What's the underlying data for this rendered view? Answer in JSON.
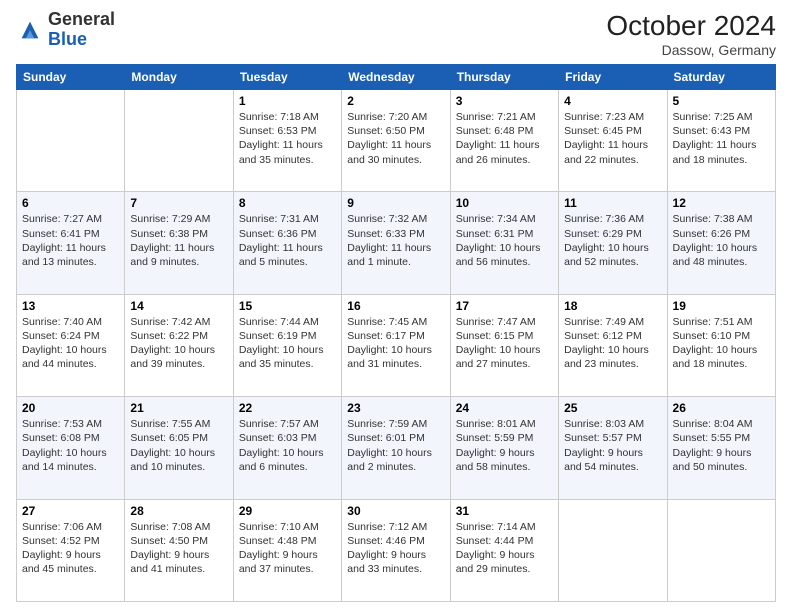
{
  "header": {
    "logo_general": "General",
    "logo_blue": "Blue",
    "month_title": "October 2024",
    "location": "Dassow, Germany"
  },
  "days_of_week": [
    "Sunday",
    "Monday",
    "Tuesday",
    "Wednesday",
    "Thursday",
    "Friday",
    "Saturday"
  ],
  "weeks": [
    [
      {
        "day": "",
        "sunrise": "",
        "sunset": "",
        "daylight": ""
      },
      {
        "day": "",
        "sunrise": "",
        "sunset": "",
        "daylight": ""
      },
      {
        "day": "1",
        "sunrise": "Sunrise: 7:18 AM",
        "sunset": "Sunset: 6:53 PM",
        "daylight": "Daylight: 11 hours and 35 minutes."
      },
      {
        "day": "2",
        "sunrise": "Sunrise: 7:20 AM",
        "sunset": "Sunset: 6:50 PM",
        "daylight": "Daylight: 11 hours and 30 minutes."
      },
      {
        "day": "3",
        "sunrise": "Sunrise: 7:21 AM",
        "sunset": "Sunset: 6:48 PM",
        "daylight": "Daylight: 11 hours and 26 minutes."
      },
      {
        "day": "4",
        "sunrise": "Sunrise: 7:23 AM",
        "sunset": "Sunset: 6:45 PM",
        "daylight": "Daylight: 11 hours and 22 minutes."
      },
      {
        "day": "5",
        "sunrise": "Sunrise: 7:25 AM",
        "sunset": "Sunset: 6:43 PM",
        "daylight": "Daylight: 11 hours and 18 minutes."
      }
    ],
    [
      {
        "day": "6",
        "sunrise": "Sunrise: 7:27 AM",
        "sunset": "Sunset: 6:41 PM",
        "daylight": "Daylight: 11 hours and 13 minutes."
      },
      {
        "day": "7",
        "sunrise": "Sunrise: 7:29 AM",
        "sunset": "Sunset: 6:38 PM",
        "daylight": "Daylight: 11 hours and 9 minutes."
      },
      {
        "day": "8",
        "sunrise": "Sunrise: 7:31 AM",
        "sunset": "Sunset: 6:36 PM",
        "daylight": "Daylight: 11 hours and 5 minutes."
      },
      {
        "day": "9",
        "sunrise": "Sunrise: 7:32 AM",
        "sunset": "Sunset: 6:33 PM",
        "daylight": "Daylight: 11 hours and 1 minute."
      },
      {
        "day": "10",
        "sunrise": "Sunrise: 7:34 AM",
        "sunset": "Sunset: 6:31 PM",
        "daylight": "Daylight: 10 hours and 56 minutes."
      },
      {
        "day": "11",
        "sunrise": "Sunrise: 7:36 AM",
        "sunset": "Sunset: 6:29 PM",
        "daylight": "Daylight: 10 hours and 52 minutes."
      },
      {
        "day": "12",
        "sunrise": "Sunrise: 7:38 AM",
        "sunset": "Sunset: 6:26 PM",
        "daylight": "Daylight: 10 hours and 48 minutes."
      }
    ],
    [
      {
        "day": "13",
        "sunrise": "Sunrise: 7:40 AM",
        "sunset": "Sunset: 6:24 PM",
        "daylight": "Daylight: 10 hours and 44 minutes."
      },
      {
        "day": "14",
        "sunrise": "Sunrise: 7:42 AM",
        "sunset": "Sunset: 6:22 PM",
        "daylight": "Daylight: 10 hours and 39 minutes."
      },
      {
        "day": "15",
        "sunrise": "Sunrise: 7:44 AM",
        "sunset": "Sunset: 6:19 PM",
        "daylight": "Daylight: 10 hours and 35 minutes."
      },
      {
        "day": "16",
        "sunrise": "Sunrise: 7:45 AM",
        "sunset": "Sunset: 6:17 PM",
        "daylight": "Daylight: 10 hours and 31 minutes."
      },
      {
        "day": "17",
        "sunrise": "Sunrise: 7:47 AM",
        "sunset": "Sunset: 6:15 PM",
        "daylight": "Daylight: 10 hours and 27 minutes."
      },
      {
        "day": "18",
        "sunrise": "Sunrise: 7:49 AM",
        "sunset": "Sunset: 6:12 PM",
        "daylight": "Daylight: 10 hours and 23 minutes."
      },
      {
        "day": "19",
        "sunrise": "Sunrise: 7:51 AM",
        "sunset": "Sunset: 6:10 PM",
        "daylight": "Daylight: 10 hours and 18 minutes."
      }
    ],
    [
      {
        "day": "20",
        "sunrise": "Sunrise: 7:53 AM",
        "sunset": "Sunset: 6:08 PM",
        "daylight": "Daylight: 10 hours and 14 minutes."
      },
      {
        "day": "21",
        "sunrise": "Sunrise: 7:55 AM",
        "sunset": "Sunset: 6:05 PM",
        "daylight": "Daylight: 10 hours and 10 minutes."
      },
      {
        "day": "22",
        "sunrise": "Sunrise: 7:57 AM",
        "sunset": "Sunset: 6:03 PM",
        "daylight": "Daylight: 10 hours and 6 minutes."
      },
      {
        "day": "23",
        "sunrise": "Sunrise: 7:59 AM",
        "sunset": "Sunset: 6:01 PM",
        "daylight": "Daylight: 10 hours and 2 minutes."
      },
      {
        "day": "24",
        "sunrise": "Sunrise: 8:01 AM",
        "sunset": "Sunset: 5:59 PM",
        "daylight": "Daylight: 9 hours and 58 minutes."
      },
      {
        "day": "25",
        "sunrise": "Sunrise: 8:03 AM",
        "sunset": "Sunset: 5:57 PM",
        "daylight": "Daylight: 9 hours and 54 minutes."
      },
      {
        "day": "26",
        "sunrise": "Sunrise: 8:04 AM",
        "sunset": "Sunset: 5:55 PM",
        "daylight": "Daylight: 9 hours and 50 minutes."
      }
    ],
    [
      {
        "day": "27",
        "sunrise": "Sunrise: 7:06 AM",
        "sunset": "Sunset: 4:52 PM",
        "daylight": "Daylight: 9 hours and 45 minutes."
      },
      {
        "day": "28",
        "sunrise": "Sunrise: 7:08 AM",
        "sunset": "Sunset: 4:50 PM",
        "daylight": "Daylight: 9 hours and 41 minutes."
      },
      {
        "day": "29",
        "sunrise": "Sunrise: 7:10 AM",
        "sunset": "Sunset: 4:48 PM",
        "daylight": "Daylight: 9 hours and 37 minutes."
      },
      {
        "day": "30",
        "sunrise": "Sunrise: 7:12 AM",
        "sunset": "Sunset: 4:46 PM",
        "daylight": "Daylight: 9 hours and 33 minutes."
      },
      {
        "day": "31",
        "sunrise": "Sunrise: 7:14 AM",
        "sunset": "Sunset: 4:44 PM",
        "daylight": "Daylight: 9 hours and 29 minutes."
      },
      {
        "day": "",
        "sunrise": "",
        "sunset": "",
        "daylight": ""
      },
      {
        "day": "",
        "sunrise": "",
        "sunset": "",
        "daylight": ""
      }
    ]
  ]
}
